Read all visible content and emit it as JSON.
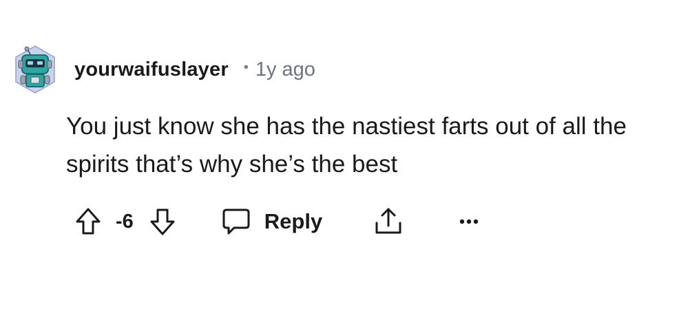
{
  "comment": {
    "author": "yourwaifuslayer",
    "separator": "•",
    "timestamp": "1y ago",
    "body": "You just know she has the nastiest farts out of all the spirits that’s why she’s the best",
    "score": "-6",
    "reply_label": "Reply",
    "avatar_icon": "robot-avatar-icon"
  },
  "icons": {
    "upvote": "arrow-up-outline-icon",
    "downvote": "arrow-down-outline-icon",
    "reply": "speech-bubble-icon",
    "share": "share-upload-icon",
    "more": "ellipsis-icon"
  },
  "colors": {
    "text": "#1a1a1b",
    "meta": "#6b7280",
    "avatar_teal": "#2fa6a3",
    "avatar_bg": "#c9d3ee"
  }
}
